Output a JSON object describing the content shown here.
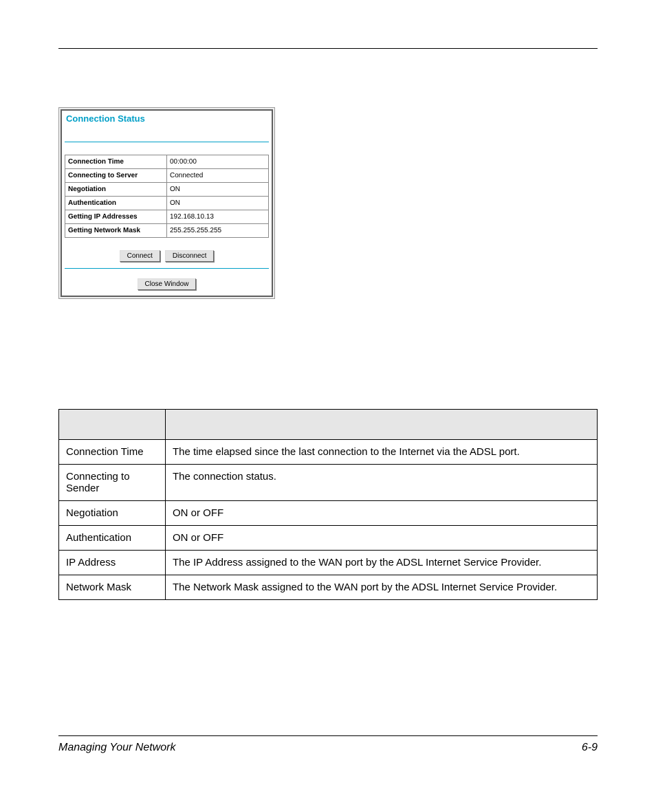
{
  "panel": {
    "title": "Connection Status",
    "rows": [
      {
        "label": "Connection Time",
        "value": "00:00:00"
      },
      {
        "label": "Connecting to Server",
        "value": "Connected"
      },
      {
        "label": "Negotiation",
        "value": "ON"
      },
      {
        "label": "Authentication",
        "value": "ON"
      },
      {
        "label": "Getting IP Addresses",
        "value": "192.168.10.13"
      },
      {
        "label": "Getting Network Mask",
        "value": "255.255.255.255"
      }
    ],
    "buttons": {
      "connect": "Connect",
      "disconnect": "Disconnect",
      "close": "Close Window"
    }
  },
  "desc": {
    "headers": {
      "param": "",
      "description": ""
    },
    "rows": [
      {
        "param": "Connection Time",
        "description": "The time elapsed since the last connection to the Internet via the ADSL port."
      },
      {
        "param": "Connecting to Sender",
        "description": "The connection status."
      },
      {
        "param": "Negotiation",
        "description": "ON or OFF"
      },
      {
        "param": "Authentication",
        "description": "ON or OFF"
      },
      {
        "param": "IP Address",
        "description": "The IP Address assigned to the WAN port by the ADSL Internet Service Provider."
      },
      {
        "param": "Network Mask",
        "description": "The Network Mask assigned to the WAN port by the ADSL Internet Service Provider."
      }
    ]
  },
  "footer": {
    "title": "Managing Your Network",
    "page": "6-9"
  }
}
